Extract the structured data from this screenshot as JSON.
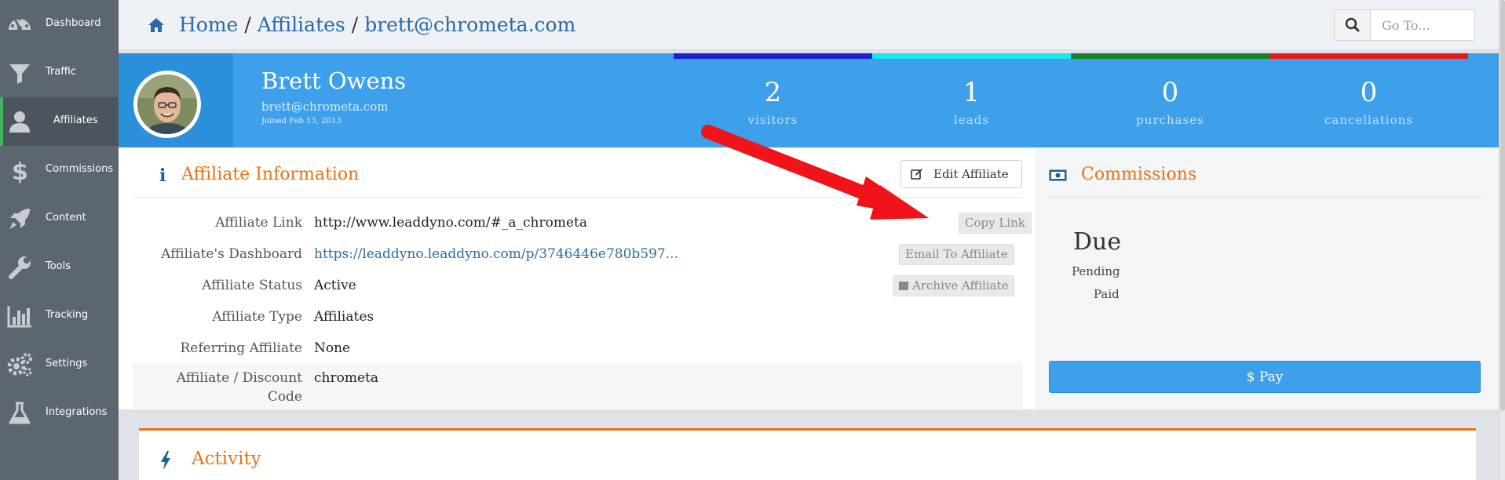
{
  "sidebar": {
    "items": [
      {
        "label": "Dashboard",
        "icon": "dashboard-icon"
      },
      {
        "label": "Traffic",
        "icon": "filter-icon"
      },
      {
        "label": "Affiliates",
        "icon": "user-icon",
        "active": true
      },
      {
        "label": "Commissions",
        "icon": "dollar-icon"
      },
      {
        "label": "Content",
        "icon": "rocket-icon"
      },
      {
        "label": "Tools",
        "icon": "wrench-icon"
      },
      {
        "label": "Tracking",
        "icon": "bar-chart-icon"
      },
      {
        "label": "Settings",
        "icon": "gears-icon"
      },
      {
        "label": "Integrations",
        "icon": "flask-icon"
      }
    ]
  },
  "breadcrumb": {
    "home": "Home",
    "section": "Affiliates",
    "current": "brett@chrometa.com"
  },
  "search": {
    "placeholder": "Go To..."
  },
  "profile": {
    "name": "Brett Owens",
    "email": "brett@chrometa.com",
    "joined": "Joined Feb 13, 2013"
  },
  "stats": [
    {
      "value": "2",
      "label": "visitors",
      "color": "#1d1fd6"
    },
    {
      "value": "1",
      "label": "leads",
      "color": "#19e6ef"
    },
    {
      "value": "0",
      "label": "purchases",
      "color": "#14812a"
    },
    {
      "value": "0",
      "label": "cancellations",
      "color": "#e51b1b"
    }
  ],
  "info": {
    "title": "Affiliate Information",
    "edit_label": "Edit Affiliate",
    "rows": [
      {
        "label": "Affiliate Link",
        "value": "http://www.leaddyno.com/#_a_chrometa"
      },
      {
        "label": "Affiliate's Dashboard",
        "value": "https://leaddyno.leaddyno.com/p/3746446e780b597..."
      },
      {
        "label": "Affiliate Status",
        "value": "Active"
      },
      {
        "label": "Affiliate Type",
        "value": "Affiliates"
      },
      {
        "label": "Referring Affiliate",
        "value": "None"
      },
      {
        "label_line1": "Affiliate / Discount",
        "label_line2": "Code",
        "value": "chrometa"
      }
    ],
    "copy_link_label": "Copy Link",
    "email_label": "Email To Affiliate",
    "archive_label": "Archive Affiliate"
  },
  "commissions": {
    "title": "Commissions",
    "due": "Due",
    "pending": "Pending",
    "paid": "Paid",
    "pay_label": "$ Pay"
  },
  "activity": {
    "title": "Activity"
  },
  "colors": {
    "accent_orange": "#e87212",
    "link_blue": "#2a6aa8",
    "hero_blue": "#3ea0ea",
    "sidebar": "#5b6670",
    "active_marker": "#3fb55f",
    "annotation_red": "#f0131a"
  }
}
